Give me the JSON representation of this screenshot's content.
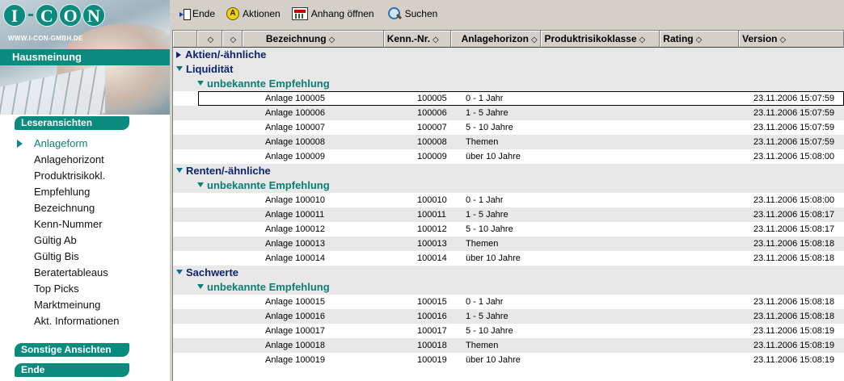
{
  "brand": {
    "logo_letters": [
      "I",
      "-",
      "C",
      "O",
      "N"
    ],
    "url": "WWW.I-CON-GMBH.DE",
    "section_title": "Hausmeinung"
  },
  "sidebar": {
    "leseransichten_label": "Leseransichten",
    "items": [
      {
        "label": "Anlageform",
        "active": true
      },
      {
        "label": "Anlagehorizont",
        "active": false
      },
      {
        "label": "Produktrisikokl.",
        "active": false
      },
      {
        "label": "Empfehlung",
        "active": false
      },
      {
        "label": "Bezeichnung",
        "active": false
      },
      {
        "label": "Kenn-Nummer",
        "active": false
      },
      {
        "label": "Gültig Ab",
        "active": false
      },
      {
        "label": "Gültig Bis",
        "active": false
      },
      {
        "label": "Beratertableaus",
        "active": false
      },
      {
        "label": "Top Picks",
        "active": false
      },
      {
        "label": "Marktmeinung",
        "active": false
      },
      {
        "label": "Akt. Informationen",
        "active": false
      }
    ],
    "sonstige_label": "Sonstige Ansichten",
    "ende_label": "Ende"
  },
  "toolbar": {
    "ende": "Ende",
    "aktionen": "Aktionen",
    "anhang": "Anhang öffnen",
    "suchen": "Suchen",
    "aktionen_icon_letter": "A"
  },
  "table": {
    "sort_glyph": "◇",
    "columns": {
      "bezeichnung": "Bezeichnung",
      "kenn": "Kenn.-Nr.",
      "horizont": "Anlagehorizon",
      "risiko": "Produktrisikoklasse",
      "rating": "Rating",
      "version": "Version"
    },
    "rows": [
      {
        "kind": "cat",
        "label": "Aktien/-ähnliche",
        "expanded": false
      },
      {
        "kind": "cat",
        "label": "Liquidität",
        "expanded": true
      },
      {
        "kind": "sub",
        "label": "unbekannte Empfehlung"
      },
      {
        "kind": "data",
        "bez": "Anlage 100005",
        "kenn": "100005",
        "horizont": "0 - 1 Jahr",
        "version": "23.11.2006 15:07:59",
        "selected": true
      },
      {
        "kind": "data",
        "bez": "Anlage 100006",
        "kenn": "100006",
        "horizont": "1 - 5 Jahre",
        "version": "23.11.2006 15:07:59"
      },
      {
        "kind": "data",
        "bez": "Anlage 100007",
        "kenn": "100007",
        "horizont": "5 - 10 Jahre",
        "version": "23.11.2006 15:07:59"
      },
      {
        "kind": "data",
        "bez": "Anlage 100008",
        "kenn": "100008",
        "horizont": "Themen",
        "version": "23.11.2006 15:07:59"
      },
      {
        "kind": "data",
        "bez": "Anlage 100009",
        "kenn": "100009",
        "horizont": "über 10 Jahre",
        "version": "23.11.2006 15:08:00"
      },
      {
        "kind": "cat",
        "label": "Renten/-ähnliche",
        "expanded": true
      },
      {
        "kind": "sub",
        "label": "unbekannte Empfehlung"
      },
      {
        "kind": "data",
        "bez": "Anlage 100010",
        "kenn": "100010",
        "horizont": "0 - 1 Jahr",
        "version": "23.11.2006 15:08:00"
      },
      {
        "kind": "data",
        "bez": "Anlage 100011",
        "kenn": "100011",
        "horizont": "1 - 5 Jahre",
        "version": "23.11.2006 15:08:17"
      },
      {
        "kind": "data",
        "bez": "Anlage 100012",
        "kenn": "100012",
        "horizont": "5 - 10 Jahre",
        "version": "23.11.2006 15:08:17"
      },
      {
        "kind": "data",
        "bez": "Anlage 100013",
        "kenn": "100013",
        "horizont": "Themen",
        "version": "23.11.2006 15:08:18"
      },
      {
        "kind": "data",
        "bez": "Anlage 100014",
        "kenn": "100014",
        "horizont": "über 10 Jahre",
        "version": "23.11.2006 15:08:18"
      },
      {
        "kind": "cat",
        "label": "Sachwerte",
        "expanded": true
      },
      {
        "kind": "sub",
        "label": "unbekannte Empfehlung"
      },
      {
        "kind": "data",
        "bez": "Anlage 100015",
        "kenn": "100015",
        "horizont": "0 - 1 Jahr",
        "version": "23.11.2006 15:08:18"
      },
      {
        "kind": "data",
        "bez": "Anlage 100016",
        "kenn": "100016",
        "horizont": "1 - 5 Jahre",
        "version": "23.11.2006 15:08:18"
      },
      {
        "kind": "data",
        "bez": "Anlage 100017",
        "kenn": "100017",
        "horizont": "5 - 10 Jahre",
        "version": "23.11.2006 15:08:19"
      },
      {
        "kind": "data",
        "bez": "Anlage 100018",
        "kenn": "100018",
        "horizont": "Themen",
        "version": "23.11.2006 15:08:19"
      },
      {
        "kind": "data",
        "bez": "Anlage 100019",
        "kenn": "100019",
        "horizont": "über 10 Jahre",
        "version": "23.11.2006 15:08:19"
      }
    ]
  },
  "colors": {
    "brand_teal": "#0b8a7e",
    "category_blue": "#0e2470",
    "toolbar_gray": "#d4d0c8"
  }
}
